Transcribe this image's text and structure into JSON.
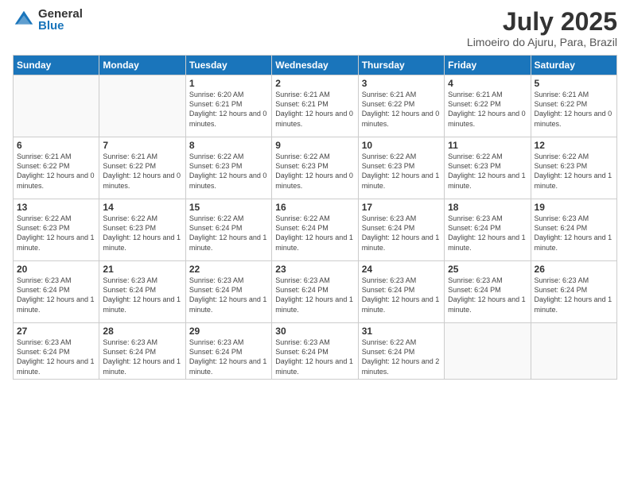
{
  "logo": {
    "general": "General",
    "blue": "Blue"
  },
  "title": {
    "month": "July 2025",
    "location": "Limoeiro do Ajuru, Para, Brazil"
  },
  "days_of_week": [
    "Sunday",
    "Monday",
    "Tuesday",
    "Wednesday",
    "Thursday",
    "Friday",
    "Saturday"
  ],
  "weeks": [
    [
      {
        "day": "",
        "info": ""
      },
      {
        "day": "",
        "info": ""
      },
      {
        "day": "1",
        "info": "Sunrise: 6:20 AM\nSunset: 6:21 PM\nDaylight: 12 hours and 0 minutes."
      },
      {
        "day": "2",
        "info": "Sunrise: 6:21 AM\nSunset: 6:21 PM\nDaylight: 12 hours and 0 minutes."
      },
      {
        "day": "3",
        "info": "Sunrise: 6:21 AM\nSunset: 6:22 PM\nDaylight: 12 hours and 0 minutes."
      },
      {
        "day": "4",
        "info": "Sunrise: 6:21 AM\nSunset: 6:22 PM\nDaylight: 12 hours and 0 minutes."
      },
      {
        "day": "5",
        "info": "Sunrise: 6:21 AM\nSunset: 6:22 PM\nDaylight: 12 hours and 0 minutes."
      }
    ],
    [
      {
        "day": "6",
        "info": "Sunrise: 6:21 AM\nSunset: 6:22 PM\nDaylight: 12 hours and 0 minutes."
      },
      {
        "day": "7",
        "info": "Sunrise: 6:21 AM\nSunset: 6:22 PM\nDaylight: 12 hours and 0 minutes."
      },
      {
        "day": "8",
        "info": "Sunrise: 6:22 AM\nSunset: 6:23 PM\nDaylight: 12 hours and 0 minutes."
      },
      {
        "day": "9",
        "info": "Sunrise: 6:22 AM\nSunset: 6:23 PM\nDaylight: 12 hours and 0 minutes."
      },
      {
        "day": "10",
        "info": "Sunrise: 6:22 AM\nSunset: 6:23 PM\nDaylight: 12 hours and 1 minute."
      },
      {
        "day": "11",
        "info": "Sunrise: 6:22 AM\nSunset: 6:23 PM\nDaylight: 12 hours and 1 minute."
      },
      {
        "day": "12",
        "info": "Sunrise: 6:22 AM\nSunset: 6:23 PM\nDaylight: 12 hours and 1 minute."
      }
    ],
    [
      {
        "day": "13",
        "info": "Sunrise: 6:22 AM\nSunset: 6:23 PM\nDaylight: 12 hours and 1 minute."
      },
      {
        "day": "14",
        "info": "Sunrise: 6:22 AM\nSunset: 6:23 PM\nDaylight: 12 hours and 1 minute."
      },
      {
        "day": "15",
        "info": "Sunrise: 6:22 AM\nSunset: 6:24 PM\nDaylight: 12 hours and 1 minute."
      },
      {
        "day": "16",
        "info": "Sunrise: 6:22 AM\nSunset: 6:24 PM\nDaylight: 12 hours and 1 minute."
      },
      {
        "day": "17",
        "info": "Sunrise: 6:23 AM\nSunset: 6:24 PM\nDaylight: 12 hours and 1 minute."
      },
      {
        "day": "18",
        "info": "Sunrise: 6:23 AM\nSunset: 6:24 PM\nDaylight: 12 hours and 1 minute."
      },
      {
        "day": "19",
        "info": "Sunrise: 6:23 AM\nSunset: 6:24 PM\nDaylight: 12 hours and 1 minute."
      }
    ],
    [
      {
        "day": "20",
        "info": "Sunrise: 6:23 AM\nSunset: 6:24 PM\nDaylight: 12 hours and 1 minute."
      },
      {
        "day": "21",
        "info": "Sunrise: 6:23 AM\nSunset: 6:24 PM\nDaylight: 12 hours and 1 minute."
      },
      {
        "day": "22",
        "info": "Sunrise: 6:23 AM\nSunset: 6:24 PM\nDaylight: 12 hours and 1 minute."
      },
      {
        "day": "23",
        "info": "Sunrise: 6:23 AM\nSunset: 6:24 PM\nDaylight: 12 hours and 1 minute."
      },
      {
        "day": "24",
        "info": "Sunrise: 6:23 AM\nSunset: 6:24 PM\nDaylight: 12 hours and 1 minute."
      },
      {
        "day": "25",
        "info": "Sunrise: 6:23 AM\nSunset: 6:24 PM\nDaylight: 12 hours and 1 minute."
      },
      {
        "day": "26",
        "info": "Sunrise: 6:23 AM\nSunset: 6:24 PM\nDaylight: 12 hours and 1 minute."
      }
    ],
    [
      {
        "day": "27",
        "info": "Sunrise: 6:23 AM\nSunset: 6:24 PM\nDaylight: 12 hours and 1 minute."
      },
      {
        "day": "28",
        "info": "Sunrise: 6:23 AM\nSunset: 6:24 PM\nDaylight: 12 hours and 1 minute."
      },
      {
        "day": "29",
        "info": "Sunrise: 6:23 AM\nSunset: 6:24 PM\nDaylight: 12 hours and 1 minute."
      },
      {
        "day": "30",
        "info": "Sunrise: 6:23 AM\nSunset: 6:24 PM\nDaylight: 12 hours and 1 minute."
      },
      {
        "day": "31",
        "info": "Sunrise: 6:22 AM\nSunset: 6:24 PM\nDaylight: 12 hours and 2 minutes."
      },
      {
        "day": "",
        "info": ""
      },
      {
        "day": "",
        "info": ""
      }
    ]
  ]
}
